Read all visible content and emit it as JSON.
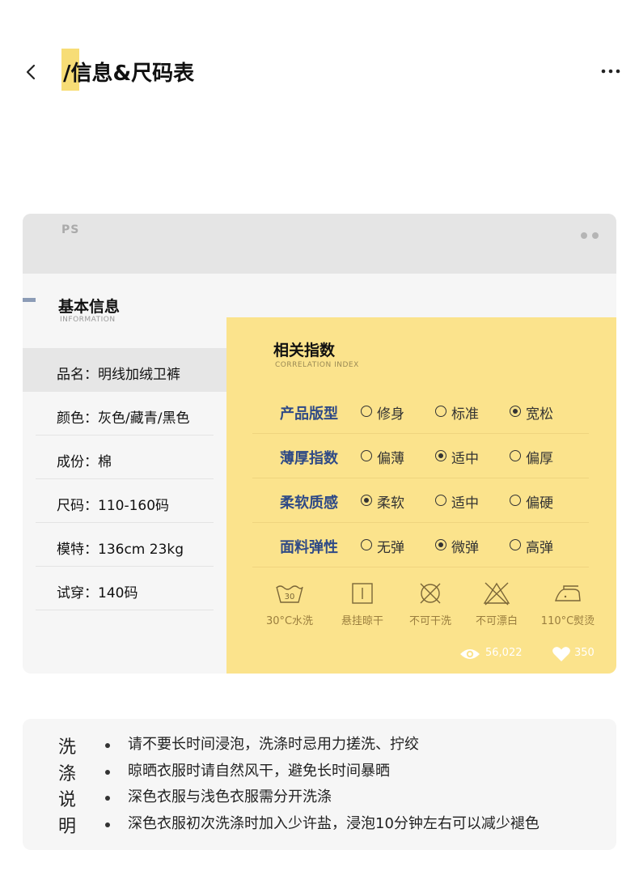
{
  "header": {
    "title": "/信息&尺码表"
  },
  "card": {
    "logo": "PS"
  },
  "basic_info": {
    "title": "基本信息",
    "subtitle": "INFORMATION",
    "rows": [
      "品名：明线加绒卫裤",
      "颜色：灰色/藏青/黑色",
      "成份：棉",
      "尺码：110-160码",
      "模特：136cm  23kg",
      "试穿：140码"
    ]
  },
  "index_panel": {
    "title": "相关指数",
    "subtitle": "CORRELATION  INDEX",
    "rows": [
      {
        "label": "产品版型",
        "options": [
          "修身",
          "标准",
          "宽松"
        ],
        "selected": 2
      },
      {
        "label": "薄厚指数",
        "options": [
          "偏薄",
          "适中",
          "偏厚"
        ],
        "selected": 1
      },
      {
        "label": "柔软质感",
        "options": [
          "柔软",
          "适中",
          "偏硬"
        ],
        "selected": 0
      },
      {
        "label": "面料弹性",
        "options": [
          "无弹",
          "微弹",
          "高弹"
        ],
        "selected": 1
      }
    ],
    "care": [
      {
        "icon": "wash-30-icon",
        "label": "30°C水洗"
      },
      {
        "icon": "hang-dry-icon",
        "label": "悬挂晾干"
      },
      {
        "icon": "no-dry-clean-icon",
        "label": "不可干洗"
      },
      {
        "icon": "no-bleach-icon",
        "label": "不可漂白"
      },
      {
        "icon": "iron-icon",
        "label": "110°C熨烫"
      }
    ],
    "views": "56,022",
    "likes": "350"
  },
  "wash_notes": {
    "title": "洗涤说明",
    "items": [
      "请不要长时间浸泡，洗涤时忌用力搓洗、拧绞",
      "晾晒衣服时请自然风干，避免长时间暴晒",
      "深色衣服与浅色衣服需分开洗涤",
      "深色衣服初次洗涤时加入少许盐，浸泡10分钟左右可以减少褪色"
    ]
  },
  "colors": {
    "panel": "#fbe38c",
    "accent": "#2f4a86",
    "title_mark": "#f7dd76"
  }
}
